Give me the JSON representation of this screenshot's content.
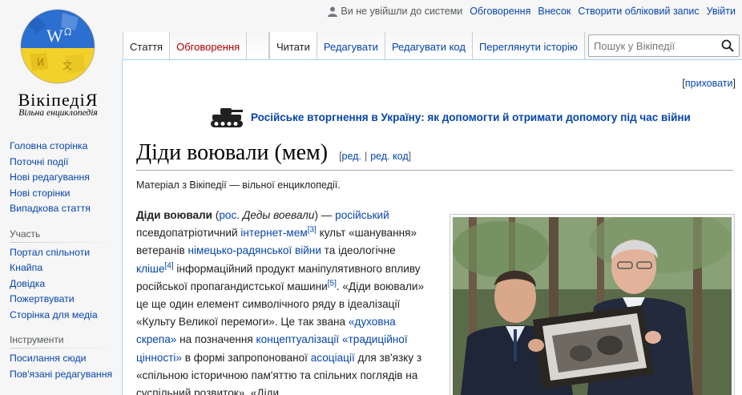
{
  "logo": {
    "wordmark": "ВікіпедіЯ",
    "tagline": "Вільна енциклопедія"
  },
  "personal": {
    "anon": "Ви не увійшли до системи",
    "talk": "Обговорення",
    "contrib": "Внесок",
    "create": "Створити обліковий запис",
    "login": "Увійти"
  },
  "tabs": {
    "article": "Стаття",
    "discussion": "Обговорення",
    "read": "Читати",
    "edit": "Редагувати",
    "edit_source": "Редагувати код",
    "history": "Переглянути історію"
  },
  "search": {
    "placeholder": "Пошук у Вікіпедії"
  },
  "sidebar": {
    "nav": [
      "Головна сторінка",
      "Поточні події",
      "Нові редагування",
      "Нові сторінки",
      "Випадкова стаття"
    ],
    "participation_heading": "Участь",
    "participation": [
      "Портал спільноти",
      "Кнайпа",
      "Довідка",
      "Пожертвувати",
      "Сторінка для медіа"
    ],
    "tools_heading": "Інструменти",
    "tools": [
      "Посилання сюди",
      "Пов'язані редагування"
    ]
  },
  "content": {
    "hide": "приховати",
    "banner": "Російське вторгнення в Україну: як допомогти й отримати допомогу під час війни",
    "title": "Діди воювали (мем)",
    "edit_link": "ред.",
    "edit_source_link": "ред. код",
    "from": "Матеріал з Вікіпедії — вільної енциклопедії.",
    "body": {
      "t1": "Діди воювали",
      "t2": " (",
      "t3": "рос.",
      "t4": " ",
      "t5": "Деды воевали",
      "t6": ") — ",
      "t7": "російський",
      "t8": " псевдопатріотичний ",
      "t9": "інтернет-мем",
      "t10": "[3]",
      "t11": " культ «шанування» ветеранів ",
      "t12": "німецько-радянської війни",
      "t13": " та ідеологічне ",
      "t14": "кліше",
      "t15": "[4]",
      "t16": " інформаційний продукт маніпулятивного впливу російської пропагандистської машини",
      "t17": "[5]",
      "t18": ". «Діди воювали» це ще один елемент символічного ряду в ідеалізації «Культу Великої перемоги». Це так звана ",
      "t19": "«духовна скрепа»",
      "t20": " на позначення ",
      "t21": "концептуалізації",
      "t22": " ",
      "t23": "«традиційної цінності»",
      "t24": " в формі запропонованої ",
      "t25": "асоціації",
      "t26": " для зв'язку з «спільною історичною пам'яттю та спільних поглядів на суспільний розвиток». «Діди"
    }
  },
  "colors": {
    "link": "#0645ad",
    "new_link": "#ba0000",
    "border_blue": "#a7d7f9"
  }
}
